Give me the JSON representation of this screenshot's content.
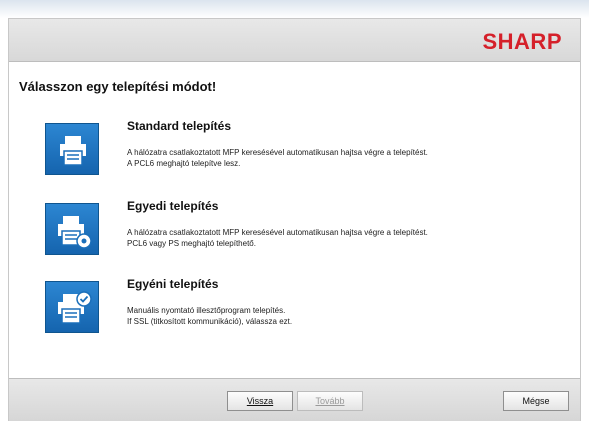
{
  "brand": {
    "logo": "SHARP",
    "logo_color": "#d5202a"
  },
  "page": {
    "title": "Válasszon egy telepítési módot!"
  },
  "options": [
    {
      "title": "Standard telepítés",
      "desc_line1": "A hálózatra csatlakoztatott MFP keresésével automatikusan hajtsa végre a telepítést.",
      "desc_line2": "A PCL6 meghajtó telepítve lesz.",
      "icon": "printer-icon"
    },
    {
      "title": "Egyedi telepítés",
      "desc_line1": "A hálózatra csatlakoztatott MFP keresésével automatikusan hajtsa végre a telepítést.",
      "desc_line2": "PCL6 vagy PS meghajtó telepíthető.",
      "icon": "printer-gear-icon"
    },
    {
      "title": "Egyéni telepítés",
      "desc_line1": "Manuális nyomtató illesztőprogram telepítés.",
      "desc_line2": "If SSL (titkosított kommunikáció), válassza ezt.",
      "icon": "printer-check-icon"
    }
  ],
  "footer": {
    "back_label": "Vissza",
    "next_label": "Tovább",
    "cancel_label": "Mégse"
  }
}
